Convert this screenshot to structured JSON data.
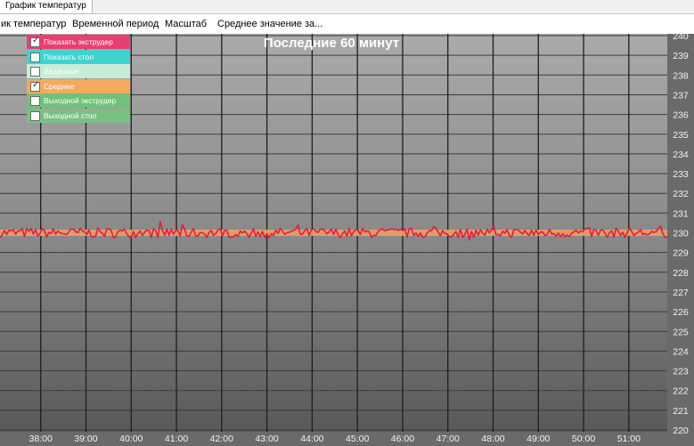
{
  "window": {
    "tab_title": "График температур"
  },
  "menu": {
    "items": [
      {
        "label": "ик температур",
        "x": 0
      },
      {
        "label": "Временной период",
        "x": 80
      },
      {
        "label": "Масштаб",
        "x": 184
      },
      {
        "label": "Среднее значение за...",
        "x": 243
      }
    ]
  },
  "chart_data": {
    "type": "line",
    "title": "Последние 60 минут",
    "x_ticks": [
      "38:00",
      "39:00",
      "40:00",
      "41:00",
      "42:00",
      "43:00",
      "44:00",
      "45:00",
      "46:00",
      "47:00",
      "48:00",
      "49:00",
      "50:00",
      "51:00"
    ],
    "x_range_minutes": [
      37.1,
      51.85
    ],
    "y_ticks": [
      220,
      221,
      222,
      223,
      224,
      225,
      226,
      227,
      228,
      229,
      230,
      231,
      232,
      233,
      234,
      235,
      236,
      237,
      238,
      239,
      240
    ],
    "ylim": [
      220,
      240
    ],
    "grid": true,
    "legend": [
      {
        "label": "Показать экструдер",
        "checked": true,
        "color": "#e83f72"
      },
      {
        "label": "Показать стол",
        "checked": false,
        "color": "#3fd3d0"
      },
      {
        "label": "Заданные",
        "checked": false,
        "color": "#c8ecd7"
      },
      {
        "label": "Среднее",
        "checked": true,
        "color": "#f4a95e"
      },
      {
        "label": "Выходной экструдер",
        "checked": false,
        "color": "#71c179"
      },
      {
        "label": "Выходной стол",
        "checked": false,
        "color": "#77c186"
      }
    ],
    "series": [
      {
        "name": "Показать экструдер",
        "color": "#dc1e4a",
        "mean": 230.0,
        "amplitude": 0.25
      },
      {
        "name": "Среднее",
        "color": "#f0a060",
        "values_constant": 230.0
      }
    ]
  }
}
